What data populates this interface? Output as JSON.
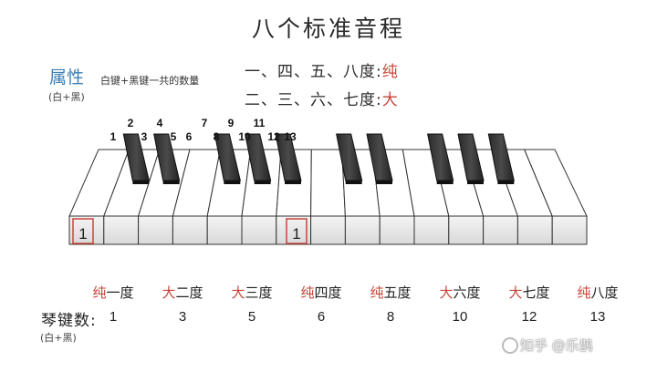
{
  "title": "八个标准音程",
  "attribute": {
    "label": "属性",
    "sub": "(白+黑)",
    "desc": "白键+黑键一共的数量"
  },
  "rules": [
    {
      "text": "一、四、五、八度:",
      "quality": "纯"
    },
    {
      "text": "二、三、六、七度:",
      "quality": "大"
    }
  ],
  "key_numbers": [
    "1",
    "2",
    "3",
    "4",
    "5",
    "6",
    "7",
    "8",
    "9",
    "10",
    "11",
    "12",
    "13"
  ],
  "start_markers": [
    "1",
    "1"
  ],
  "intervals": [
    {
      "quality": "纯",
      "name": "一度",
      "keys": "1"
    },
    {
      "quality": "大",
      "name": "二度",
      "keys": "3"
    },
    {
      "quality": "大",
      "name": "三度",
      "keys": "5"
    },
    {
      "quality": "纯",
      "name": "四度",
      "keys": "6"
    },
    {
      "quality": "纯",
      "name": "五度",
      "keys": "8"
    },
    {
      "quality": "大",
      "name": "六度",
      "keys": "10"
    },
    {
      "quality": "大",
      "name": "七度",
      "keys": "12"
    },
    {
      "quality": "纯",
      "name": "八度",
      "keys": "13"
    }
  ],
  "count_label": "琴键数:",
  "count_sub": "(白+黑)",
  "watermark": "知乎 @乐鹊",
  "colors": {
    "accent_red": "#c8453a",
    "accent_blue": "#3f7fb3"
  }
}
